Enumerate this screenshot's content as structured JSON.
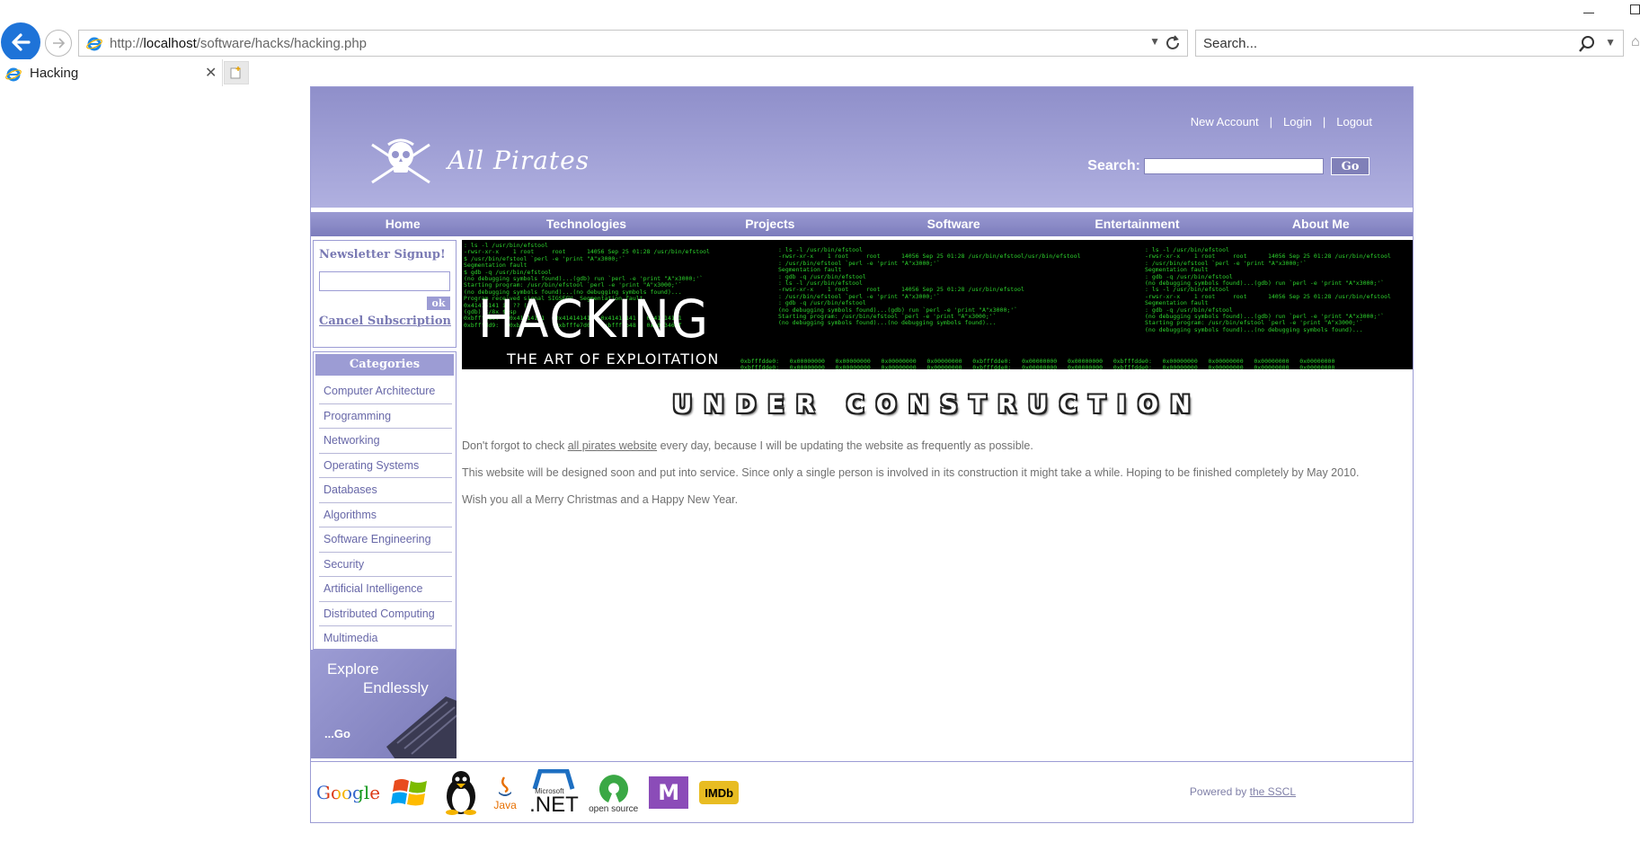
{
  "browser": {
    "url_prefix": "http://",
    "url_host": "localhost",
    "url_path": "/software/hacks/hacking.php",
    "search_placeholder": "Search...",
    "tab_title": "Hacking"
  },
  "header": {
    "logo_text": "All Pirates",
    "links": [
      "New Account",
      "Login",
      "Logout"
    ],
    "search_label": "Search:",
    "go_label": "Go"
  },
  "nav": [
    "Home",
    "Technologies",
    "Projects",
    "Software",
    "Entertainment",
    "About Me"
  ],
  "newsletter": {
    "title": "Newsletter Signup!",
    "ok_label": "ok",
    "cancel_label": "Cancel Subscription"
  },
  "categories": {
    "title": "Categories",
    "items": [
      "Computer Architecture",
      "Programming",
      "Networking",
      "Operating Systems",
      "Databases",
      "Algorithms",
      "Software Engineering",
      "Security",
      "Artificial Intelligence",
      "Distributed Computing",
      "Multimedia"
    ]
  },
  "explore": {
    "line1": "Explore",
    "line2": "Endlessly",
    "go": "...Go"
  },
  "banner": {
    "title": "HACKING",
    "subtitle": "THE ART OF EXPLOITATION"
  },
  "content": {
    "heading": "UNDER CONSTRUCTION",
    "p1_before": "Don't forgot to check ",
    "p1_link": "all pirates website",
    "p1_after": " every day, because I will be updating the website as frequently as possible.",
    "p2": "This website will be designed soon and put into service. Since only a single person is involved in its construction it might take a while. Hoping to be finished completely by May 2010.",
    "p3": "Wish you all a Merry Christmas and a Happy New Year."
  },
  "footer": {
    "logos": [
      "Google",
      "Windows",
      "Linux",
      "Java",
      "Microsoft .NET",
      "open source",
      "MTV",
      "IMDb"
    ],
    "logo_text": {
      "google": "Google",
      "java": "Java",
      "net_small": "Microsoft",
      "net_big": ".NET",
      "opensource": "open source",
      "mtv": "M",
      "imdb": "IMDb"
    },
    "powered_prefix": "Powered by ",
    "powered_link": "the SSCL"
  },
  "colors": {
    "header_top": "#8f8fca",
    "header_bottom": "#b0b0e0",
    "accent": "#9c9cd4",
    "link": "#6868a8",
    "browser_back": "#1e73d8"
  }
}
